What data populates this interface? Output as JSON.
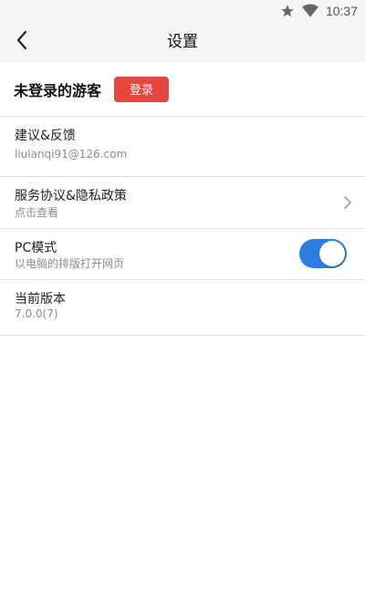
{
  "status_bar": {
    "time": "10:37",
    "icons": [
      "star-icon",
      "wifi-icon"
    ]
  },
  "app_bar": {
    "title": "设置",
    "back_icon": "chevron-left-icon"
  },
  "account": {
    "guest_label": "未登录的游客",
    "login_button": "登录"
  },
  "items": [
    {
      "title": "建议&反馈",
      "subtitle": "liulanqi91@126.com"
    },
    {
      "title": "服务协议&隐私政策",
      "subtitle": "点击查看",
      "trailing_icon": "chevron-right-icon"
    },
    {
      "title": "PC模式",
      "subtitle": "以电脑的排版打开网页",
      "toggle_on": true
    },
    {
      "title": "当前版本",
      "subtitle": "7.0.0(7)"
    }
  ],
  "colors": {
    "accent_red": "#e5463f",
    "toggle_blue": "#2e7de1",
    "bar_bg": "#f5f5f5"
  }
}
